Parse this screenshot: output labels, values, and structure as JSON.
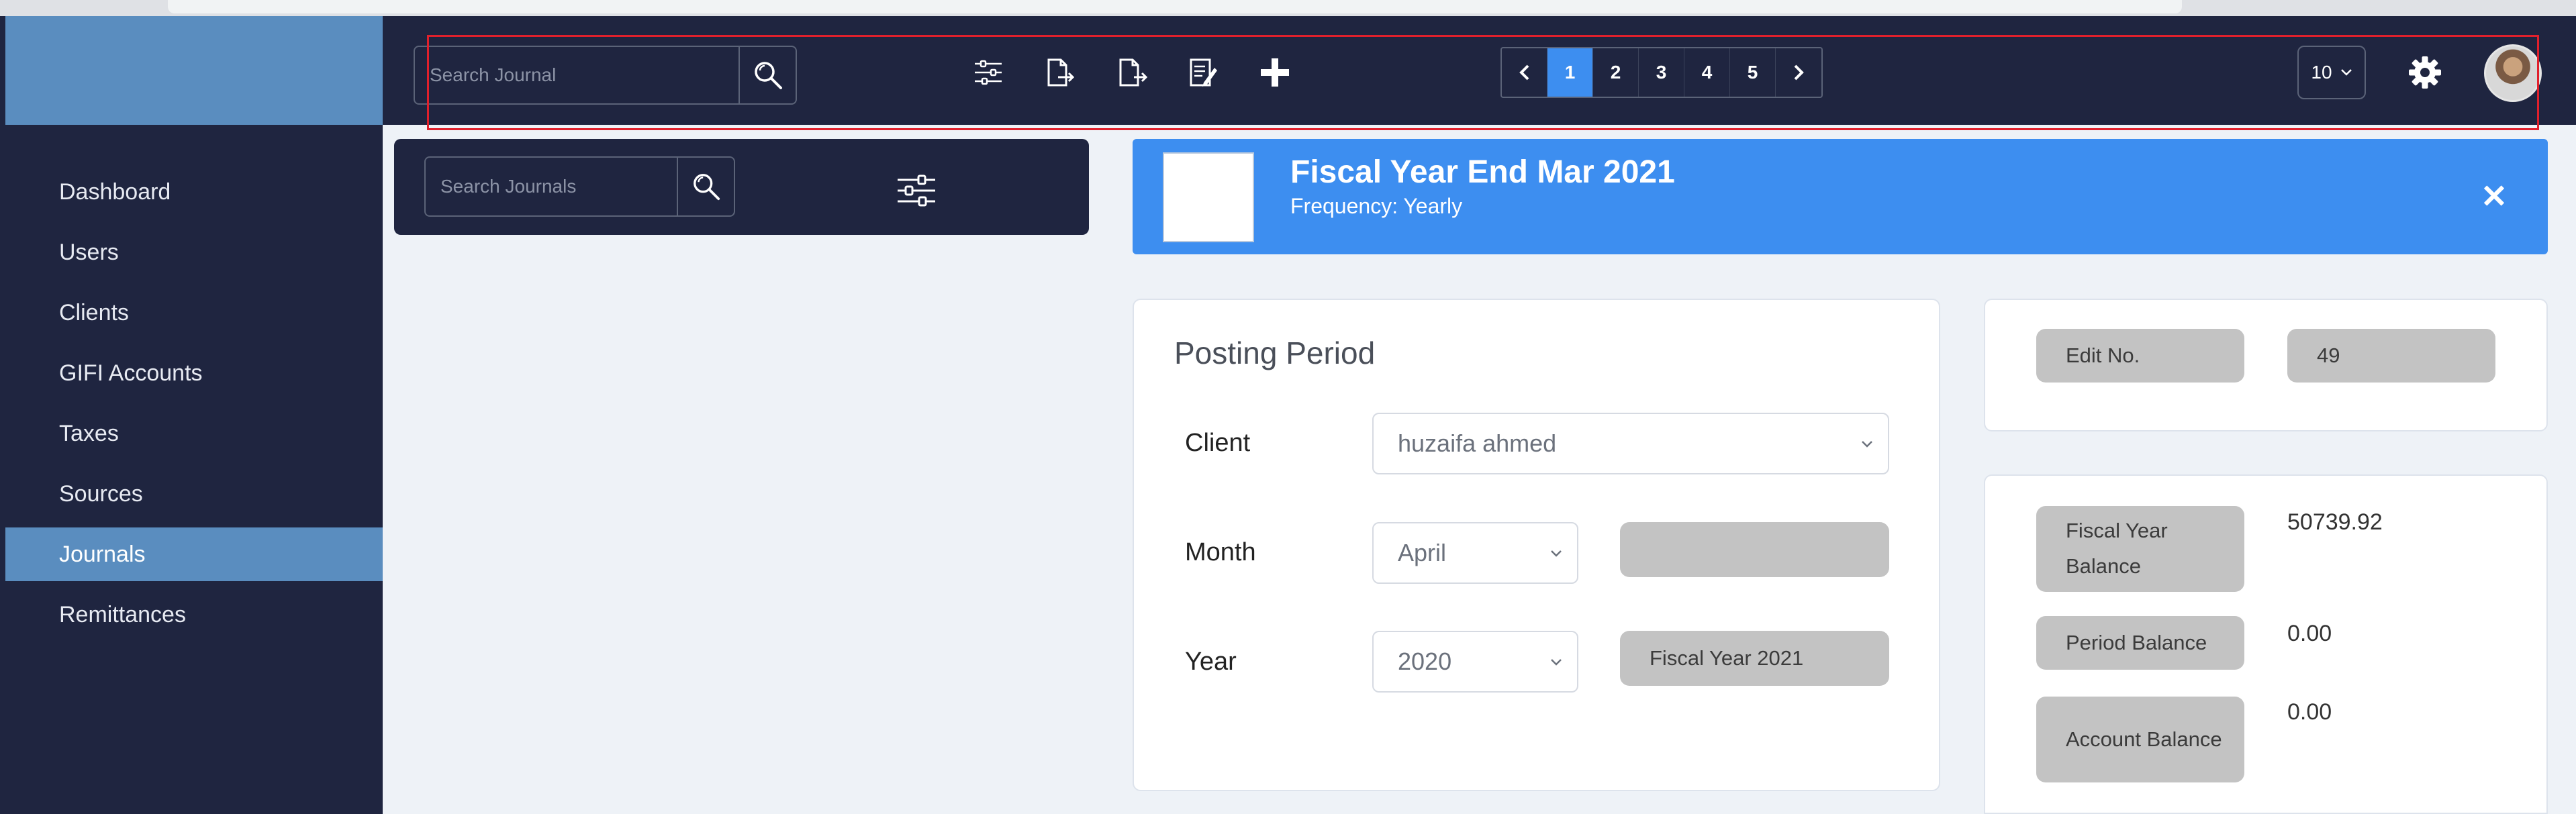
{
  "topbar": {
    "search_placeholder": "Search Journal",
    "pagination": {
      "pages": [
        "1",
        "2",
        "3",
        "4",
        "5"
      ],
      "active_page": "1"
    },
    "per_page": "10"
  },
  "sidebar": {
    "items": [
      {
        "label": "Dashboard"
      },
      {
        "label": "Users"
      },
      {
        "label": "Clients"
      },
      {
        "label": "GIFI Accounts"
      },
      {
        "label": "Taxes"
      },
      {
        "label": "Sources"
      },
      {
        "label": "Journals"
      },
      {
        "label": "Remittances"
      }
    ],
    "active_item": "Journals"
  },
  "left_panel": {
    "search_placeholder": "Search Journals"
  },
  "header": {
    "title": "Fiscal Year End Mar 2021",
    "subtitle": "Frequency: Yearly"
  },
  "posting_period": {
    "title": "Posting Period",
    "client_label": "Client",
    "client_value": "huzaifa ahmed",
    "month_label": "Month",
    "month_value": "April",
    "month_extra": "",
    "year_label": "Year",
    "year_value": "2020",
    "year_extra": "Fiscal Year 2021"
  },
  "edit_card": {
    "label": "Edit No.",
    "value": "49"
  },
  "balances": {
    "fiscal_year_label": "Fiscal Year Balance",
    "fiscal_year_value": "50739.92",
    "period_label": "Period Balance",
    "period_value": "0.00",
    "account_label": "Account Balance",
    "account_value": "0.00"
  },
  "colors": {
    "navy": "#1f2540",
    "accent_blue": "#3d8ef0",
    "sidebar_active": "#5a8dbf",
    "highlight_red": "#e0202c",
    "grey_pill": "#c3c3c3"
  },
  "icons": [
    "search-icon",
    "filter-sliders-icon",
    "export-file-icon",
    "import-file-icon",
    "edit-document-icon",
    "plus-icon",
    "chevron-left-icon",
    "chevron-right-icon",
    "chevron-down-icon",
    "gear-icon",
    "close-icon"
  ]
}
